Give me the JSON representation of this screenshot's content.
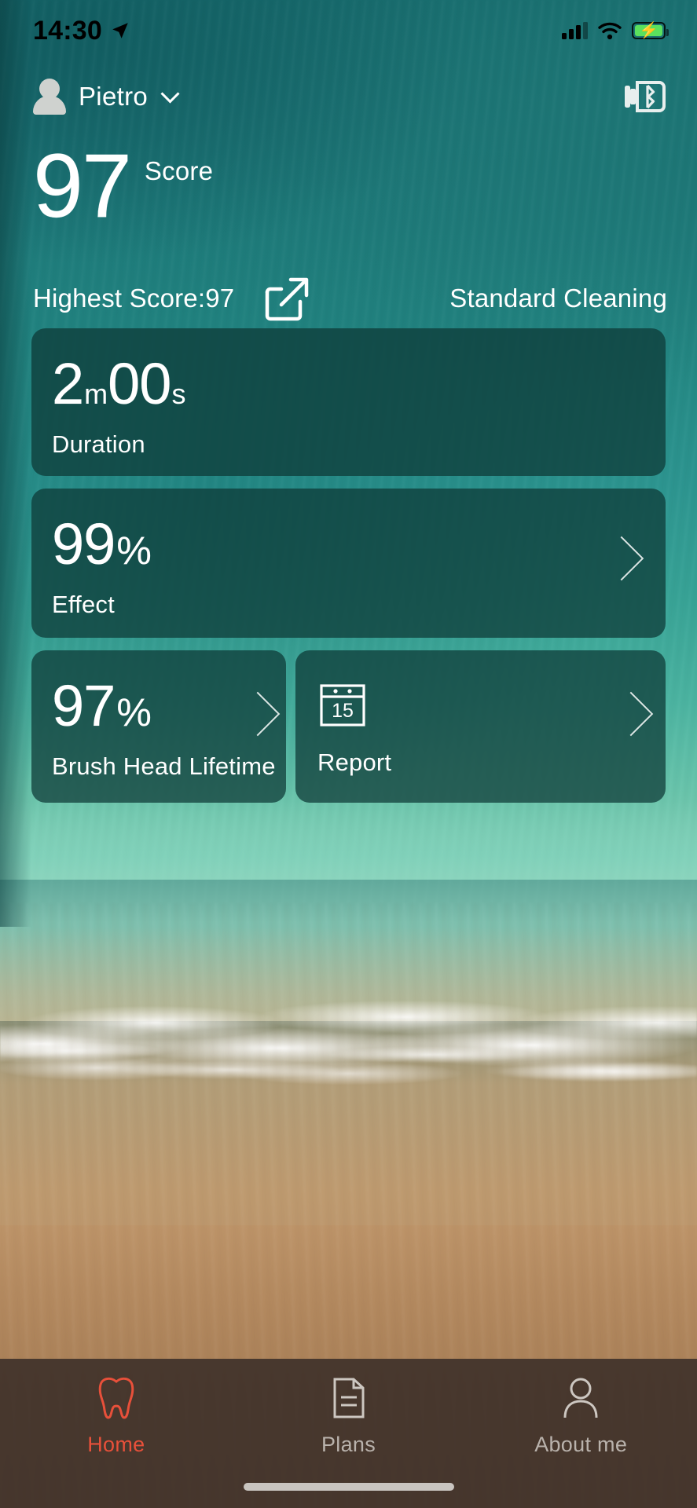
{
  "status_bar": {
    "time": "14:30",
    "location_icon": "location-arrow-icon",
    "cellular_icon": "cellular-signal-icon",
    "wifi_icon": "wifi-icon",
    "battery_icon": "battery-charging-icon",
    "battery_color": "#5ae05d"
  },
  "header": {
    "user_name": "Pietro",
    "avatar_icon": "user-avatar-icon",
    "dropdown_icon": "chevron-down-icon",
    "device_icon": "toothbrush-bluetooth-icon"
  },
  "score": {
    "value": "97",
    "label": "Score",
    "highest": "Highest Score:97",
    "share_icon": "share-export-icon",
    "mode": "Standard Cleaning"
  },
  "cards": {
    "duration": {
      "value": "2",
      "unit1": "m",
      "value2": "00",
      "unit2": "s",
      "label": "Duration",
      "has_chevron": false
    },
    "effect": {
      "value": "99",
      "unit": "%",
      "label": "Effect",
      "chevron_icon": "chevron-right-icon",
      "has_chevron": true
    },
    "brush_head": {
      "value": "97",
      "unit": "%",
      "label": "Brush Head Lifetime",
      "chevron_icon": "chevron-right-icon",
      "has_chevron": true
    },
    "report": {
      "calendar_icon": "calendar-icon",
      "calendar_day": "15",
      "label": "Report",
      "chevron_icon": "chevron-right-icon",
      "has_chevron": true
    }
  },
  "tabbar": {
    "accent_color": "#e8503a",
    "inactive_color": "#b9b2ac",
    "items": [
      {
        "label": "Home",
        "icon": "tooth-icon",
        "active": true
      },
      {
        "label": "Plans",
        "icon": "document-icon",
        "active": false
      },
      {
        "label": "About me",
        "icon": "person-icon",
        "active": false
      }
    ]
  }
}
